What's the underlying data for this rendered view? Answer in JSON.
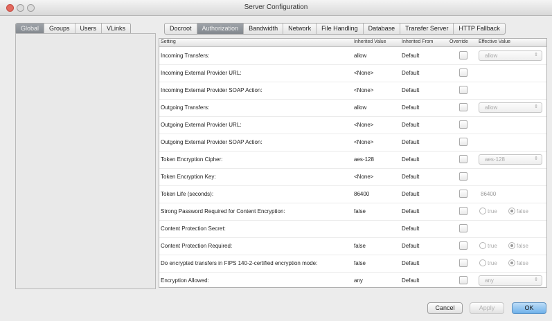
{
  "window": {
    "title": "Server Configuration"
  },
  "left_tabs": [
    "Global",
    "Groups",
    "Users",
    "VLinks"
  ],
  "right_tabs": [
    "Docroot",
    "Authorization",
    "Bandwidth",
    "Network",
    "File Handling",
    "Database",
    "Transfer Server",
    "HTTP Fallback"
  ],
  "table": {
    "headers": [
      "Setting",
      "Inherited Value",
      "Inherited From",
      "Override",
      "Effective Value"
    ],
    "rows": [
      {
        "setting": "Incoming Transfers:",
        "inherited_value": "allow",
        "inherited_from": "Default",
        "effective_value": "allow"
      },
      {
        "setting": "Incoming External Provider URL:",
        "inherited_value": "<None>",
        "inherited_from": "Default"
      },
      {
        "setting": "Incoming External Provider SOAP Action:",
        "inherited_value": "<None>",
        "inherited_from": "Default"
      },
      {
        "setting": "Outgoing Transfers:",
        "inherited_value": "allow",
        "inherited_from": "Default",
        "effective_value": "allow"
      },
      {
        "setting": "Outgoing External Provider URL:",
        "inherited_value": "<None>",
        "inherited_from": "Default"
      },
      {
        "setting": "Outgoing External Provider SOAP Action:",
        "inherited_value": "<None>",
        "inherited_from": "Default"
      },
      {
        "setting": "Token Encryption Cipher:",
        "inherited_value": "aes-128",
        "inherited_from": "Default",
        "effective_value": "aes-128"
      },
      {
        "setting": "Token Encryption Key:",
        "inherited_value": "<None>",
        "inherited_from": "Default"
      },
      {
        "setting": "Token Life (seconds):",
        "inherited_value": "86400",
        "inherited_from": "Default",
        "effective_value": "86400"
      },
      {
        "setting": "Strong Password Required for Content Encryption:",
        "inherited_value": "false",
        "inherited_from": "Default"
      },
      {
        "setting": "Content Protection Secret:",
        "inherited_value": "",
        "inherited_from": "Default"
      },
      {
        "setting": "Content Protection Required:",
        "inherited_value": "false",
        "inherited_from": "Default"
      },
      {
        "setting": "Do encrypted transfers in FIPS 140-2-certified encryption mode:",
        "inherited_value": "false",
        "inherited_from": "Default"
      },
      {
        "setting": "Encryption Allowed:",
        "inherited_value": "any",
        "inherited_from": "Default",
        "effective_value": "any"
      }
    ],
    "radio_labels": {
      "true": "true",
      "false": "false"
    },
    "dropdown_arrow": "⇕"
  },
  "buttons": {
    "cancel": "Cancel",
    "apply": "Apply",
    "ok": "OK"
  }
}
